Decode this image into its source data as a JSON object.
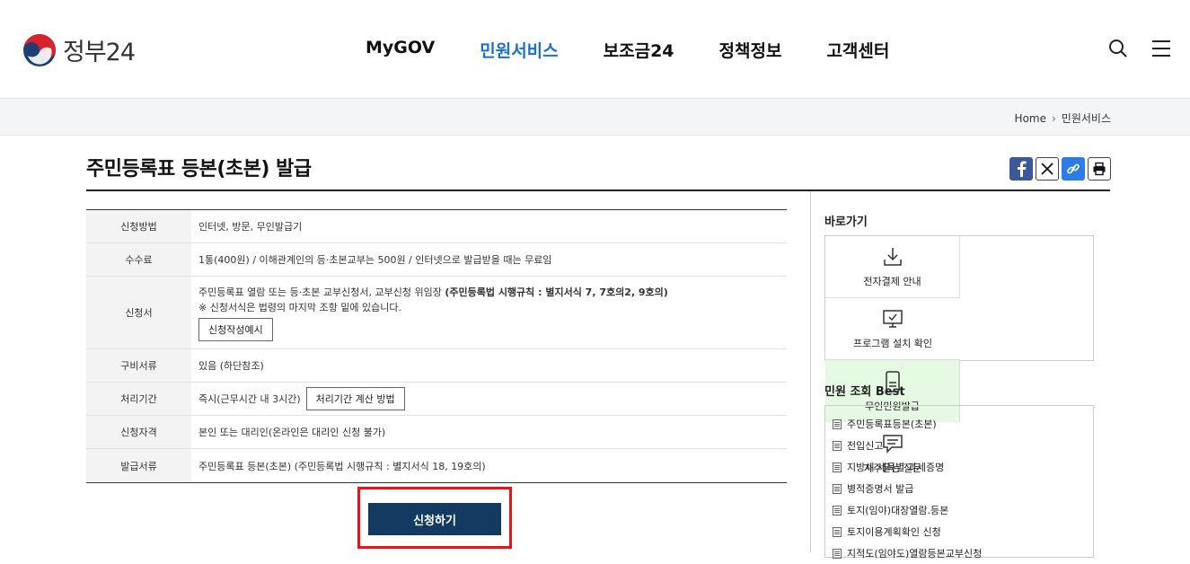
{
  "header": {
    "logo_text": "정부24",
    "nav": [
      "MyGOV",
      "민원서비스",
      "보조금24",
      "정책정보",
      "고객센터"
    ],
    "nav_active_index": 1,
    "icons": [
      "search-icon",
      "menu-icon"
    ]
  },
  "breadcrumb": {
    "home": "Home",
    "current": "민원서비스"
  },
  "page": {
    "title": "주민등록표 등본(초본) 발급"
  },
  "share_icons": [
    "facebook-icon",
    "x-icon",
    "link-icon",
    "print-icon"
  ],
  "info": {
    "rows": [
      {
        "label": "신청방법",
        "value": "인터넷, 방문, 무인발급기"
      },
      {
        "label": "수수료",
        "value": "1통(400원) / 이해관계인의 등·초본교부는 500원 / 인터넷으로 발급받을 때는 무료임"
      },
      {
        "label": "신청서",
        "line1": "주민등록표 열람 또는 등·초본 교부신청서, 교부신청 위임장 ",
        "line1_bold": "(주민등록법 시행규칙 : 별지서식 7, 7호의2, 9호의)",
        "line2": "※ 신청서식은 법령의 마지막 조항 밑에 있습니다.",
        "button": "신청작성예시"
      },
      {
        "label": "구비서류",
        "value": "있음 (하단참조)"
      },
      {
        "label": "처리기간",
        "value": "즉시(근무시간 내 3시간)",
        "button": "처리기간 계산 방법"
      },
      {
        "label": "신청자격",
        "value": "본인 또는 대리인(온라인은 대리인 신청 불가)"
      },
      {
        "label": "발급서류",
        "value": "주민등록표 등본(초본) (주민등록법 시행규칙 : 별지서식 18, 19호의)"
      }
    ]
  },
  "apply_button": "신청하기",
  "sidebar": {
    "quick_title": "바로가기",
    "quick": [
      {
        "label": "전자결제 안내",
        "icon": "download-icon"
      },
      {
        "label": "프로그램 설치 확인",
        "icon": "monitor-check-icon"
      },
      {
        "label": "무인민원발급",
        "icon": "kiosk-icon"
      },
      {
        "label": "자주묻는 질문",
        "icon": "chat-icon"
      }
    ],
    "best_title": "민원 조회 Best",
    "best": [
      "주민등록표등본(초본)",
      "전입신고",
      "지방세 세목별 과세증명",
      "병적증명서 발급",
      "토지(임야)대장열람.등본",
      "토지이용계획확인 신청",
      "지적도(임야도)열람등본교부신청"
    ]
  },
  "colors": {
    "accent": "#1a6fd1",
    "button": "#133b62",
    "highlight_border": "#e8141b",
    "kiosk_bg": "#e6f9e3"
  }
}
